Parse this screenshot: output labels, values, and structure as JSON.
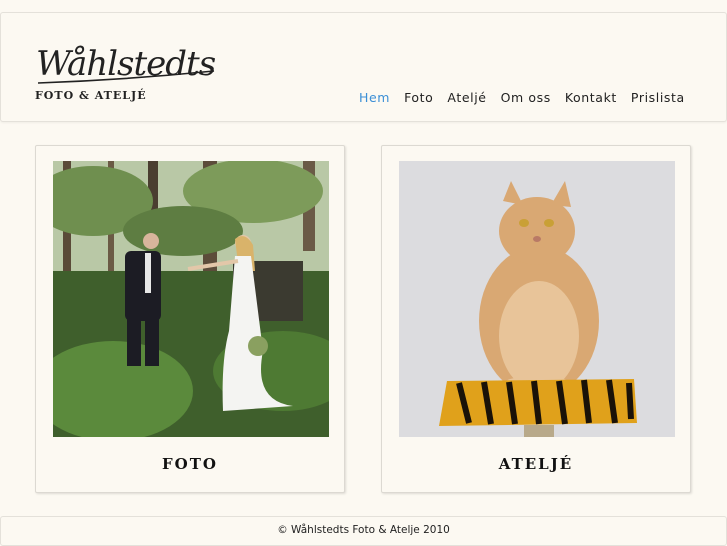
{
  "logo": {
    "script": "Wåhlstedts",
    "subtitle": "FOTO & ATELJÉ"
  },
  "nav": {
    "items": [
      {
        "label": "Hem",
        "active": true
      },
      {
        "label": "Foto"
      },
      {
        "label": "Ateljé"
      },
      {
        "label": "Om oss"
      },
      {
        "label": "Kontakt"
      },
      {
        "label": "Prislista"
      }
    ]
  },
  "cards": [
    {
      "label": "FOTO",
      "image": "wedding-couple-forest-photo"
    },
    {
      "label": "ATELJÉ",
      "image": "cat-on-tiger-cushion-photo"
    }
  ],
  "footer": {
    "text": "© Wåhlstedts Foto & Atelje 2010"
  },
  "colors": {
    "accent": "#3b8fd6",
    "background": "#fcf9f2",
    "text": "#222222"
  }
}
